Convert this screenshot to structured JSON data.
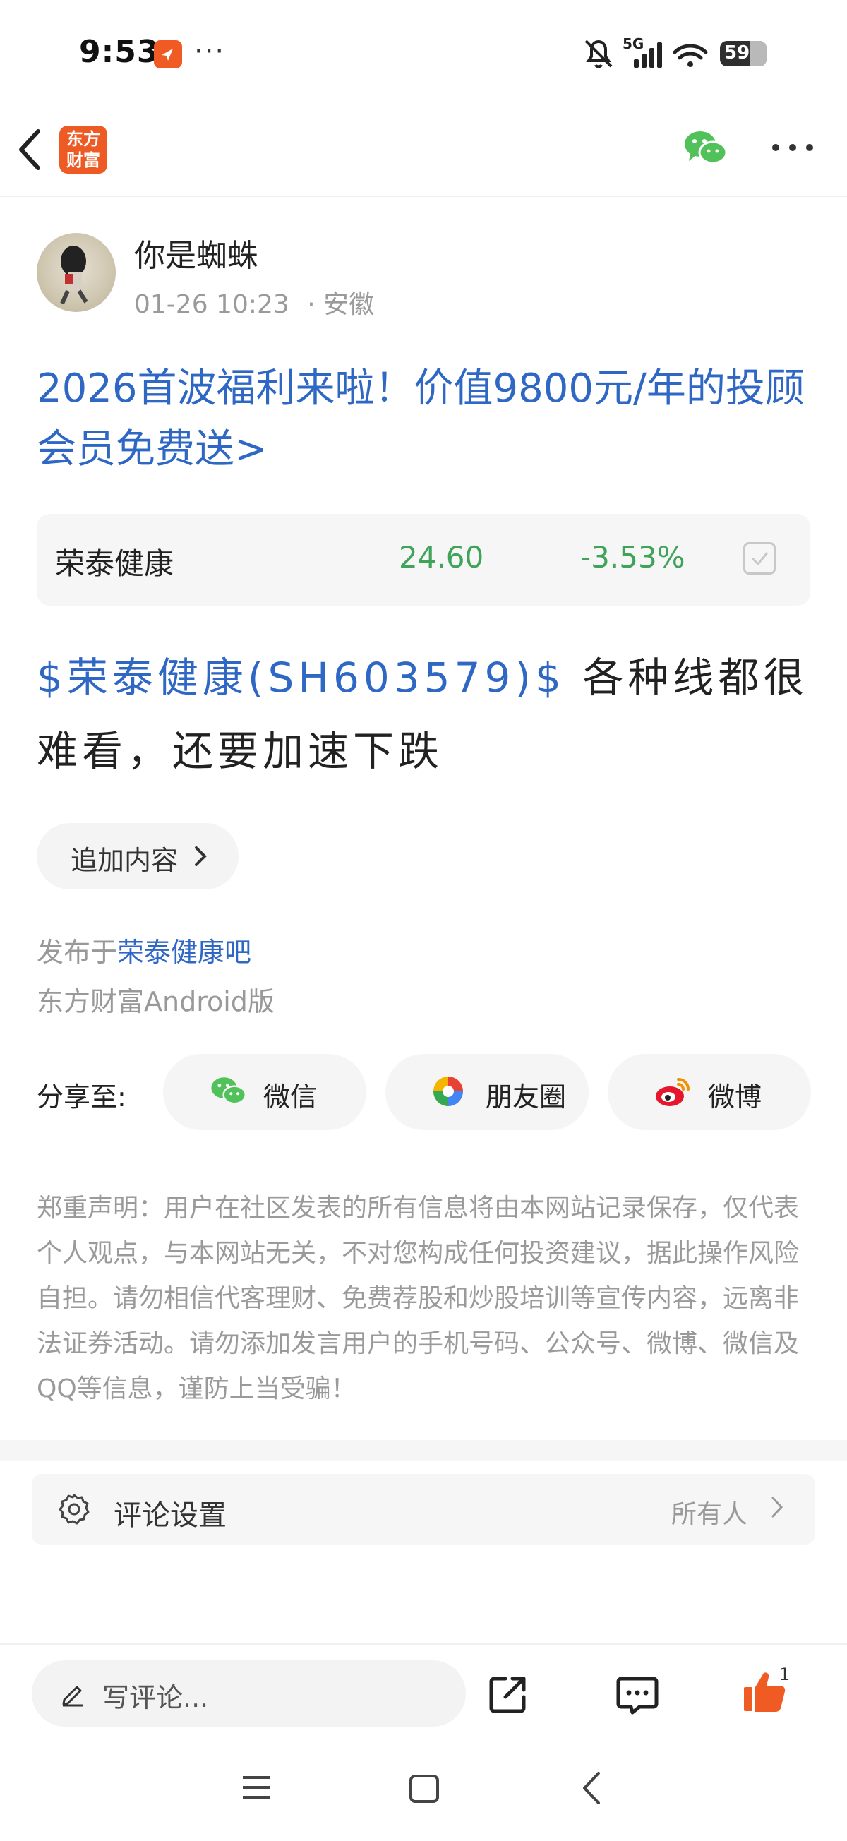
{
  "status_bar": {
    "time": "9:53",
    "overflow": "···",
    "network": "5G",
    "battery": "59",
    "icons": [
      "notification-app-icon",
      "mute-icon",
      "signal-icon",
      "wifi-icon",
      "battery-icon"
    ]
  },
  "header": {
    "brand_line1": "东方",
    "brand_line2": "财富",
    "icons": [
      "back-icon",
      "wechat-icon",
      "more-icon"
    ]
  },
  "author": {
    "name": "你是蜘蛛",
    "date": "01-26 10:23",
    "location": "· 安徽"
  },
  "promo": {
    "text": "2026首波福利来啦！价值9800元/年的投顾会员免费送>"
  },
  "stock_card": {
    "name": "荣泰健康",
    "price": "24.60",
    "change": "-3.53%",
    "price_color": "#3fa45a"
  },
  "post": {
    "stock_tag": "$荣泰健康(SH603579)$",
    "text": " 各种线都很难看，还要加速下跌"
  },
  "add_content": {
    "label": "追加内容"
  },
  "publish": {
    "prefix": "发布于",
    "forum": "荣泰健康吧",
    "client": "东方财富Android版"
  },
  "share": {
    "label": "分享至:",
    "buttons": [
      {
        "label": "微信",
        "icon": "wechat-icon"
      },
      {
        "label": "朋友圈",
        "icon": "moments-icon"
      },
      {
        "label": "微博",
        "icon": "weibo-icon"
      }
    ]
  },
  "disclaimer": "郑重声明：用户在社区发表的所有信息将由本网站记录保存，仅代表个人观点，与本网站无关，不对您构成任何投资建议，据此操作风险自担。请勿相信代客理财、免费荐股和炒股培训等宣传内容，远离非法证券活动。请勿添加发言用户的手机号码、公众号、微博、微信及QQ等信息，谨防上当受骗！",
  "comment_settings": {
    "label": "评论设置",
    "value": "所有人"
  },
  "bottom_bar": {
    "comment_placeholder": "写评论...",
    "like_count": "1",
    "accent": "#f05a23"
  },
  "colors": {
    "link_blue": "#2e67c4",
    "stock_down_green": "#3fa45a",
    "brand_orange": "#ee5a24"
  }
}
